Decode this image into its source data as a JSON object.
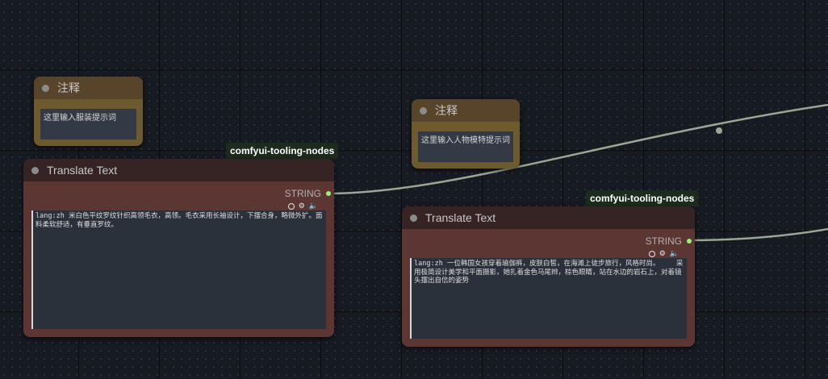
{
  "notes": [
    {
      "title": "注释",
      "text": "这里输入服装提示词"
    },
    {
      "title": "注释",
      "text": "这里输入人物模特提示词"
    }
  ],
  "translate_nodes": [
    {
      "title": "Translate Text",
      "badge": "comfyui-tooling-nodes",
      "output_label": "STRING",
      "text": "lang:zh 米白色平纹罗纹针织高领毛衣，高领。毛衣采用长袖设计，下摆合身，略微外扩。面料柔软舒适，有垂直罗纹。"
    },
    {
      "title": "Translate Text",
      "badge": "comfyui-tooling-nodes",
      "output_label": "STRING",
      "text": "lang:zh 一位韩国女孩穿着瑜伽裤，皮肤白皙，在海滩上徒步旅行，风格时尚。    采用极简设计美学和平面摄影，她扎着金色马尾辫，棕色眼睛，站在水边的岩石上，对着镜头摆出自信的姿势"
    }
  ],
  "icons": [
    "radio-circle-icon",
    "gear-icon",
    "speaker-icon"
  ],
  "colors": {
    "canvas_bg": "#161a21",
    "note_body": "#6e5a2f",
    "note_header": "#57442b",
    "translate_body": "#5b3633",
    "translate_header": "#362424",
    "output_slot": "#9ff07a",
    "link": "#9aa794"
  }
}
